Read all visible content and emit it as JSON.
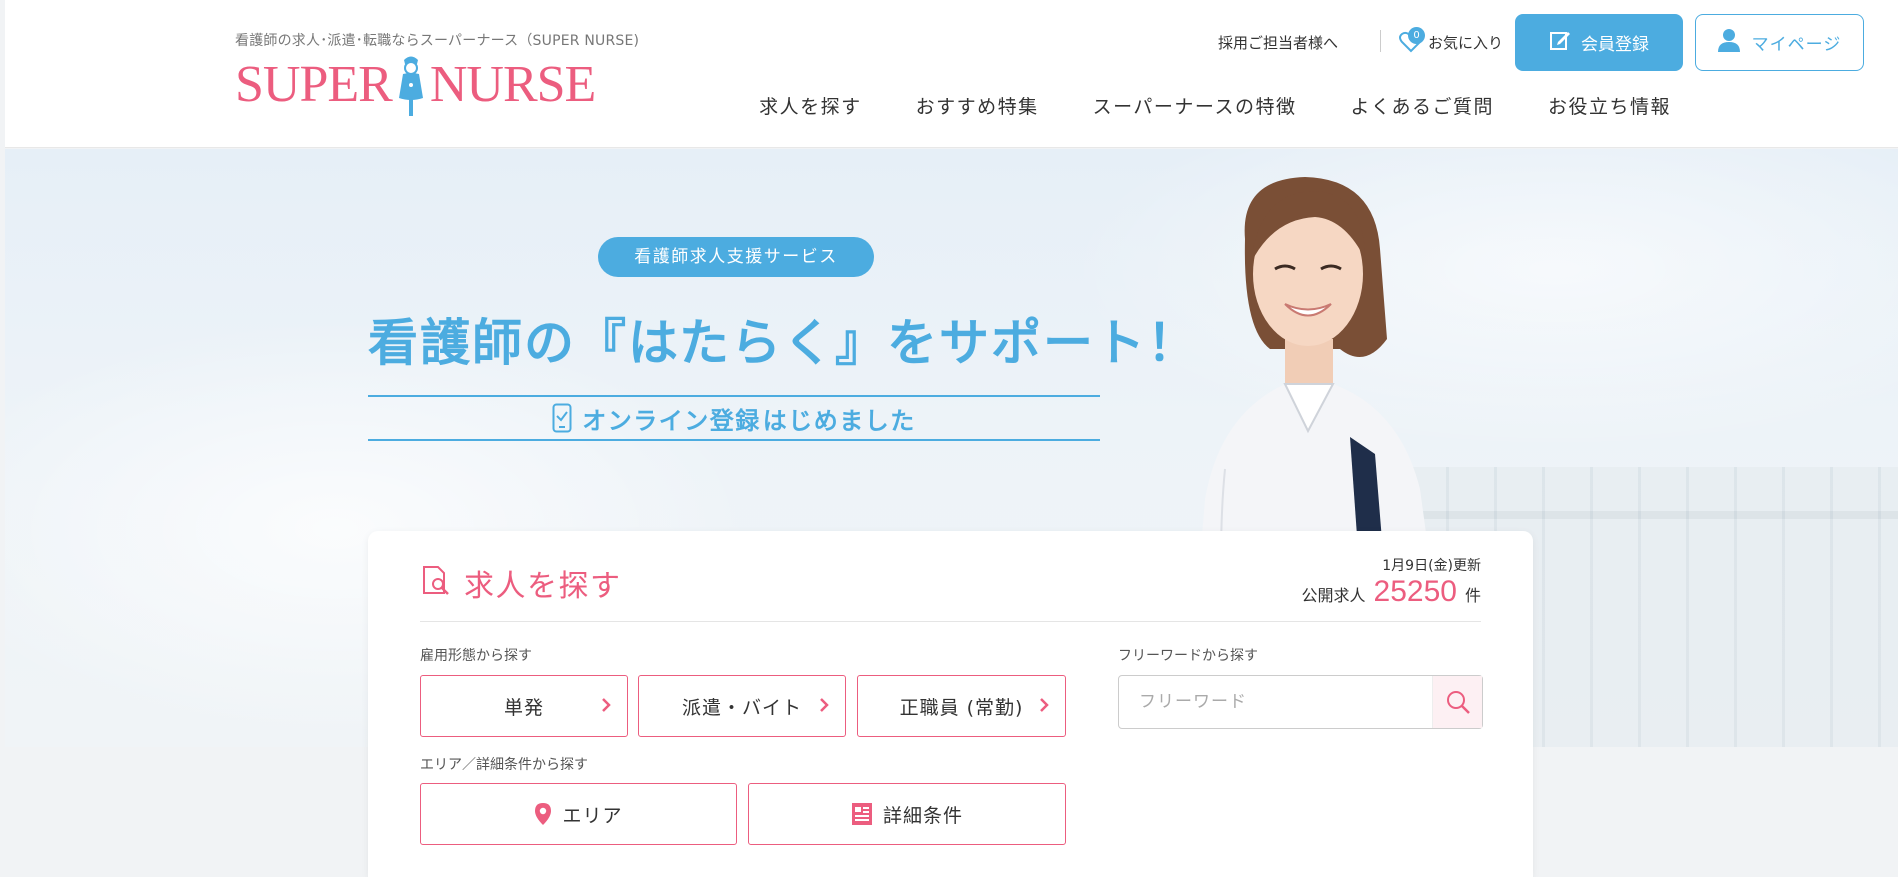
{
  "header": {
    "tagline": "看護師の求人･派遣･転職ならスーパーナース（SUPER NURSE)",
    "logo_left": "SUPER",
    "logo_right": "NURSE",
    "employer_link": "採用ご担当者様へ",
    "favorites_label": "お気に入り",
    "favorites_count": "0",
    "register_label": "会員登録",
    "mypage_label": "マイページ",
    "nav": [
      "求人を探す",
      "おすすめ特集",
      "スーパーナースの特徴",
      "よくあるご質問",
      "お役立ち情報"
    ]
  },
  "hero": {
    "pill": "看護師求人支援サービス",
    "headline": "看護師の『はたらく』をサポート！",
    "subline_strong": "オンライン登録",
    "subline_rest": "はじめました"
  },
  "search": {
    "title": "求人を探す",
    "updated": "1月9日(金)更新",
    "count_prefix": "公開求人",
    "count": "25250",
    "count_suffix": "件",
    "employment_label": "雇用形態から探す",
    "employment_types": [
      "単発",
      "派遣・バイト",
      "正職員 (常勤)"
    ],
    "freeword_label": "フリーワードから探す",
    "freeword_placeholder": "フリーワード",
    "area_label": "エリア／詳細条件から探す",
    "area_button": "エリア",
    "detail_button": "詳細条件"
  },
  "colors": {
    "brand_pink": "#ec5d7f",
    "brand_blue": "#4cace0"
  },
  "icons": [
    "nurse-logo-icon",
    "heart-icon",
    "pencil-icon",
    "user-icon",
    "phone-icon",
    "search-doc-icon",
    "chevron-right-icon",
    "search-icon",
    "map-pin-icon",
    "document-icon"
  ]
}
